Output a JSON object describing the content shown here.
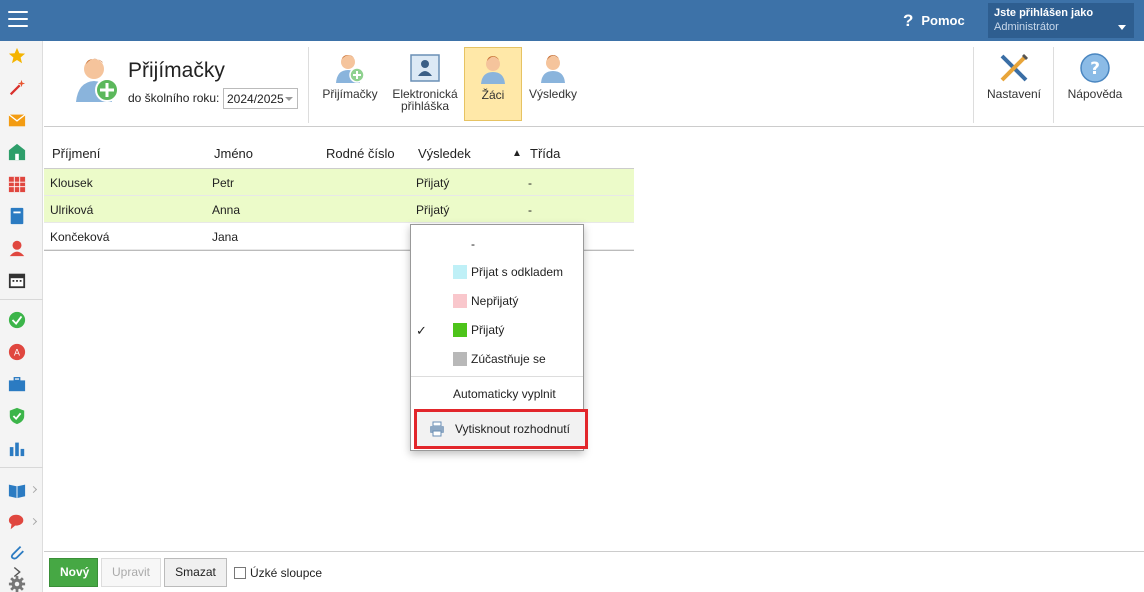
{
  "topbar": {
    "help_label": "Pomoc",
    "user_line1": "Jste přihlášen jako",
    "user_line2": "Administrátor"
  },
  "header": {
    "title": "Přijímačky",
    "year_label": "do školního roku:",
    "year_value": "2024/2025"
  },
  "toolbar": {
    "tools": [
      {
        "label": "Přijímačky",
        "icon": "person-add-icon"
      },
      {
        "label_line1": "Elektronická",
        "label_line2": "přihláška",
        "icon": "id-card-icon"
      },
      {
        "label": "Žáci",
        "icon": "person-icon",
        "active": true
      },
      {
        "label": "Výsledky",
        "icon": "person-icon"
      }
    ],
    "settings_label": "Nastavení",
    "help_label": "Nápověda"
  },
  "table": {
    "columns": [
      "Příjmení",
      "Jméno",
      "Rodné číslo",
      "Výsledek",
      "Třída"
    ],
    "sort_indicator": "▲",
    "rows": [
      {
        "prijmeni": "Klousek",
        "jmeno": "Petr",
        "rodne_cislo": "",
        "vysledek": "Přijatý",
        "trida": "-"
      },
      {
        "prijmeni": "Ulriková",
        "jmeno": "Anna",
        "rodne_cislo": "",
        "vysledek": "Přijatý",
        "trida": "-"
      },
      {
        "prijmeni": "Končeková",
        "jmeno": "Jana",
        "rodne_cislo": "",
        "vysledek": "",
        "trida": ""
      }
    ]
  },
  "menu": {
    "items": [
      {
        "label": "-",
        "color": ""
      },
      {
        "label": "Přijat s odkladem",
        "color": "#bff0f7"
      },
      {
        "label": "Nepřijatý",
        "color": "#f9c7cc"
      },
      {
        "label": "Přijatý",
        "color": "#4dc41a",
        "checked": true
      },
      {
        "label": "Zúčastňuje se",
        "color": "#b8b8b8"
      }
    ],
    "check_mark": "✓",
    "auto_fill": "Automaticky vyplnit",
    "print_decision": "Vytisknout rozhodnutí"
  },
  "footer": {
    "new_label": "Nový",
    "edit_label": "Upravit",
    "delete_label": "Smazat",
    "narrow_label": "Úzké sloupce"
  },
  "colors": {
    "topbar": "#3d72a8",
    "accepted_row": "#ecfbc9",
    "highlight_border": "#e2262b",
    "primary_button": "#46a844"
  }
}
